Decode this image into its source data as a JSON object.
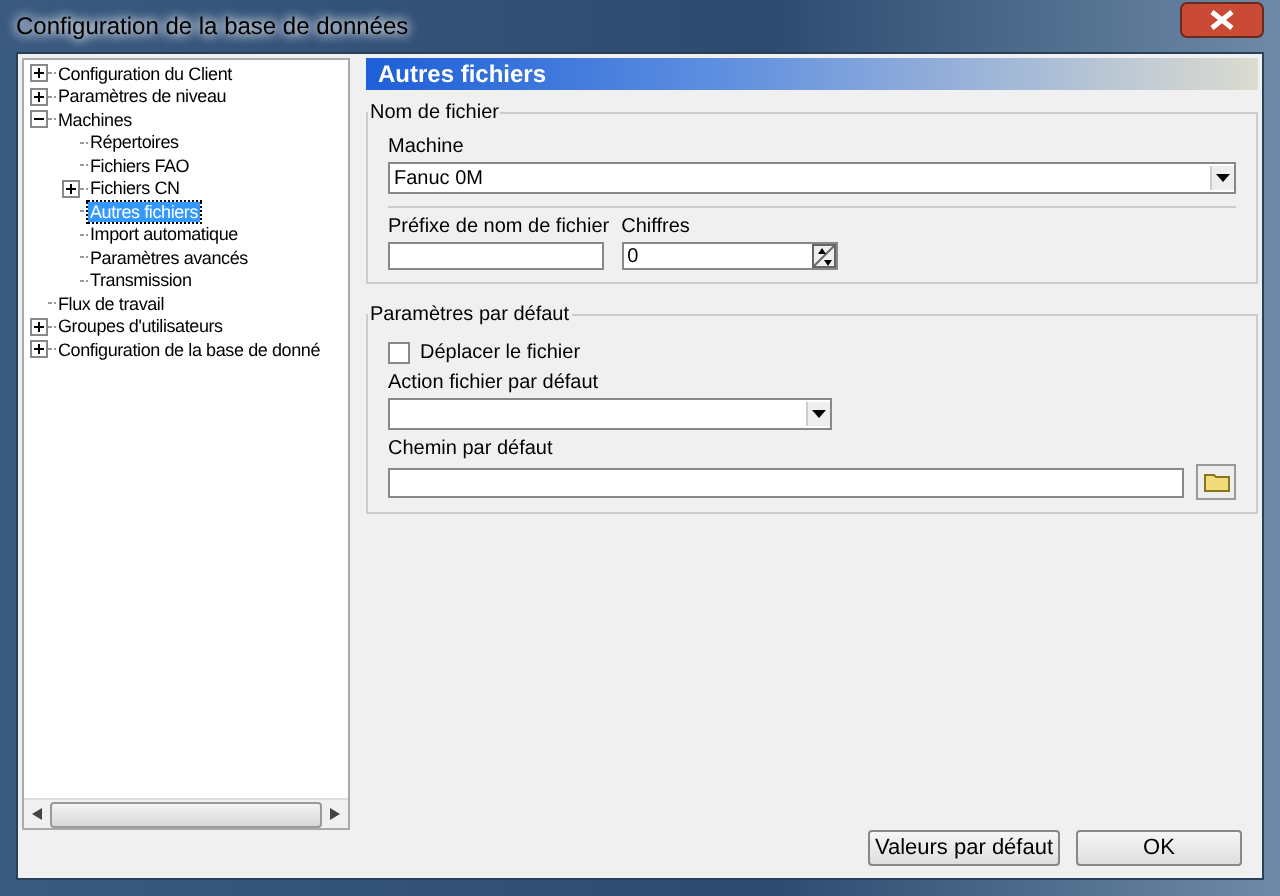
{
  "window": {
    "title": "Configuration de la base de données"
  },
  "tree": [
    {
      "label": "Configuration du Client",
      "expanded": false,
      "selected": false
    },
    {
      "label": "Paramètres de niveau",
      "expanded": false,
      "selected": false
    },
    {
      "label": "Machines",
      "expanded": true,
      "selected": false,
      "children": [
        {
          "label": "Répertoires",
          "selected": false
        },
        {
          "label": "Fichiers FAO",
          "selected": false
        },
        {
          "label": "Fichiers CN",
          "expanded": false,
          "selected": false
        },
        {
          "label": "Autres fichiers",
          "selected": true
        },
        {
          "label": "Import automatique",
          "selected": false
        },
        {
          "label": "Paramètres avancés",
          "selected": false
        },
        {
          "label": "Transmission",
          "selected": false
        }
      ]
    },
    {
      "label": "Flux de travail",
      "selected": false
    },
    {
      "label": "Groupes d'utilisateurs",
      "expanded": false,
      "selected": false
    },
    {
      "label": "Configuration de la base de donné",
      "expanded": false,
      "selected": false
    }
  ],
  "panel": {
    "title": "Autres fichiers",
    "file_name_group": {
      "title": "Nom de fichier",
      "machine_label": "Machine",
      "machine_value": "Fanuc 0M",
      "prefix_label": "Préfixe de nom de fichier",
      "digits_label": "Chiffres",
      "digits_value": "0"
    },
    "defaults_group": {
      "title": "Paramètres par défaut",
      "move_file": {
        "label": "Déplacer le fichier",
        "checked": false
      },
      "action_label": "Action fichier par défaut",
      "path_label": "Chemin par défaut"
    }
  },
  "buttons": [
    "Valeurs par défaut",
    "OK"
  ]
}
